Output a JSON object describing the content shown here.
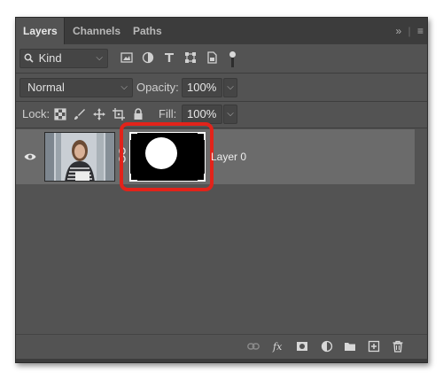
{
  "tabs": [
    {
      "label": "Layers",
      "active": true
    },
    {
      "label": "Channels",
      "active": false
    },
    {
      "label": "Paths",
      "active": false
    }
  ],
  "panel_menu": {
    "collapse_icon": "double-chevron-right",
    "menu_icon": "hamburger"
  },
  "filter": {
    "kind_label": "Kind",
    "icons": [
      "pixel-filter-icon",
      "adjustment-filter-icon",
      "type-filter-icon",
      "shape-filter-icon",
      "smart-object-filter-icon"
    ]
  },
  "blend": {
    "mode": "Normal"
  },
  "opacity": {
    "label": "Opacity:",
    "value": "100%"
  },
  "lock": {
    "label": "Lock:",
    "icons": [
      "lock-transparent-icon",
      "lock-image-icon",
      "lock-position-icon",
      "lock-artboard-icon",
      "lock-all-icon"
    ]
  },
  "fill": {
    "label": "Fill:",
    "value": "100%"
  },
  "layers": [
    {
      "name": "Layer 0",
      "visible": true,
      "has_mask": true,
      "mask_selected": true
    }
  ],
  "bottom_icons": [
    "link-layers-icon",
    "fx-icon",
    "add-mask-icon",
    "adjustment-layer-icon",
    "group-icon",
    "new-layer-icon",
    "trash-icon"
  ],
  "colors": {
    "panel": "#535353",
    "tabbar": "#3c3c3c",
    "selected_layer": "#6b6b6b",
    "highlight": "#e2231a"
  }
}
